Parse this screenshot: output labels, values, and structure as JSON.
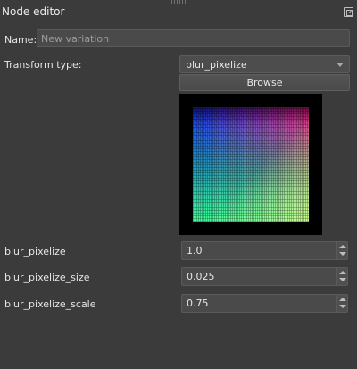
{
  "panel": {
    "title": "Node editor",
    "float_icon": "undock-icon"
  },
  "name": {
    "label": "Name:",
    "value": "New variation"
  },
  "transform": {
    "label": "Transform type:",
    "selected": "blur_pixelize",
    "browse_label": "Browse"
  },
  "preview": {
    "description_colors": [
      "#1028ff",
      "#ff1a8c",
      "#3cff96",
      "#ffff8c",
      "#000000"
    ]
  },
  "params": [
    {
      "label": "blur_pixelize",
      "value": "1.0"
    },
    {
      "label": "blur_pixelize_size",
      "value": "0.025"
    },
    {
      "label": "blur_pixelize_scale",
      "value": "0.75"
    }
  ],
  "colors": {
    "background": "#3b3b3b",
    "input_bg": "#4a4a4a",
    "text": "#e6e6e6",
    "placeholder_text": "#9c9c9c"
  }
}
